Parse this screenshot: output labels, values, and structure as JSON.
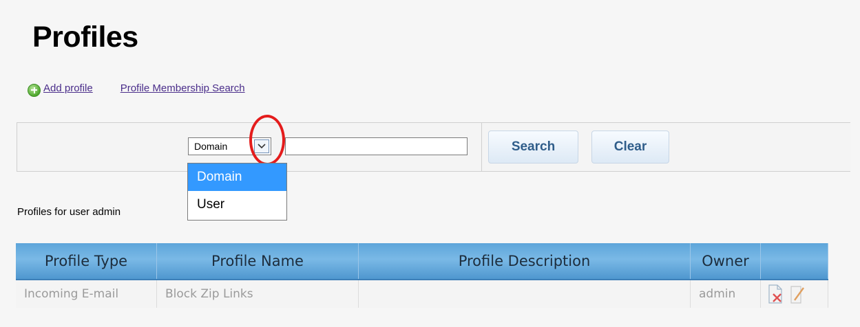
{
  "page": {
    "title": "Profiles"
  },
  "actions": {
    "add_profile": "Add profile",
    "membership_search": "Profile Membership Search"
  },
  "search": {
    "type_selected": "Domain",
    "type_options": [
      "Domain",
      "User"
    ],
    "query_value": "",
    "search_button": "Search",
    "clear_button": "Clear"
  },
  "caption": "Profiles for user admin",
  "table": {
    "headers": [
      "Profile Type",
      "Profile Name",
      "Profile Description",
      "Owner",
      ""
    ],
    "rows": [
      {
        "type": "Incoming E-mail",
        "name": "Block Zip Links",
        "description": "",
        "owner": "admin"
      }
    ]
  },
  "colors": {
    "header_blue": "#5da5da",
    "link_purple": "#4a2d8a",
    "highlight_red": "#e41c1c",
    "selection_blue": "#3399ff"
  }
}
